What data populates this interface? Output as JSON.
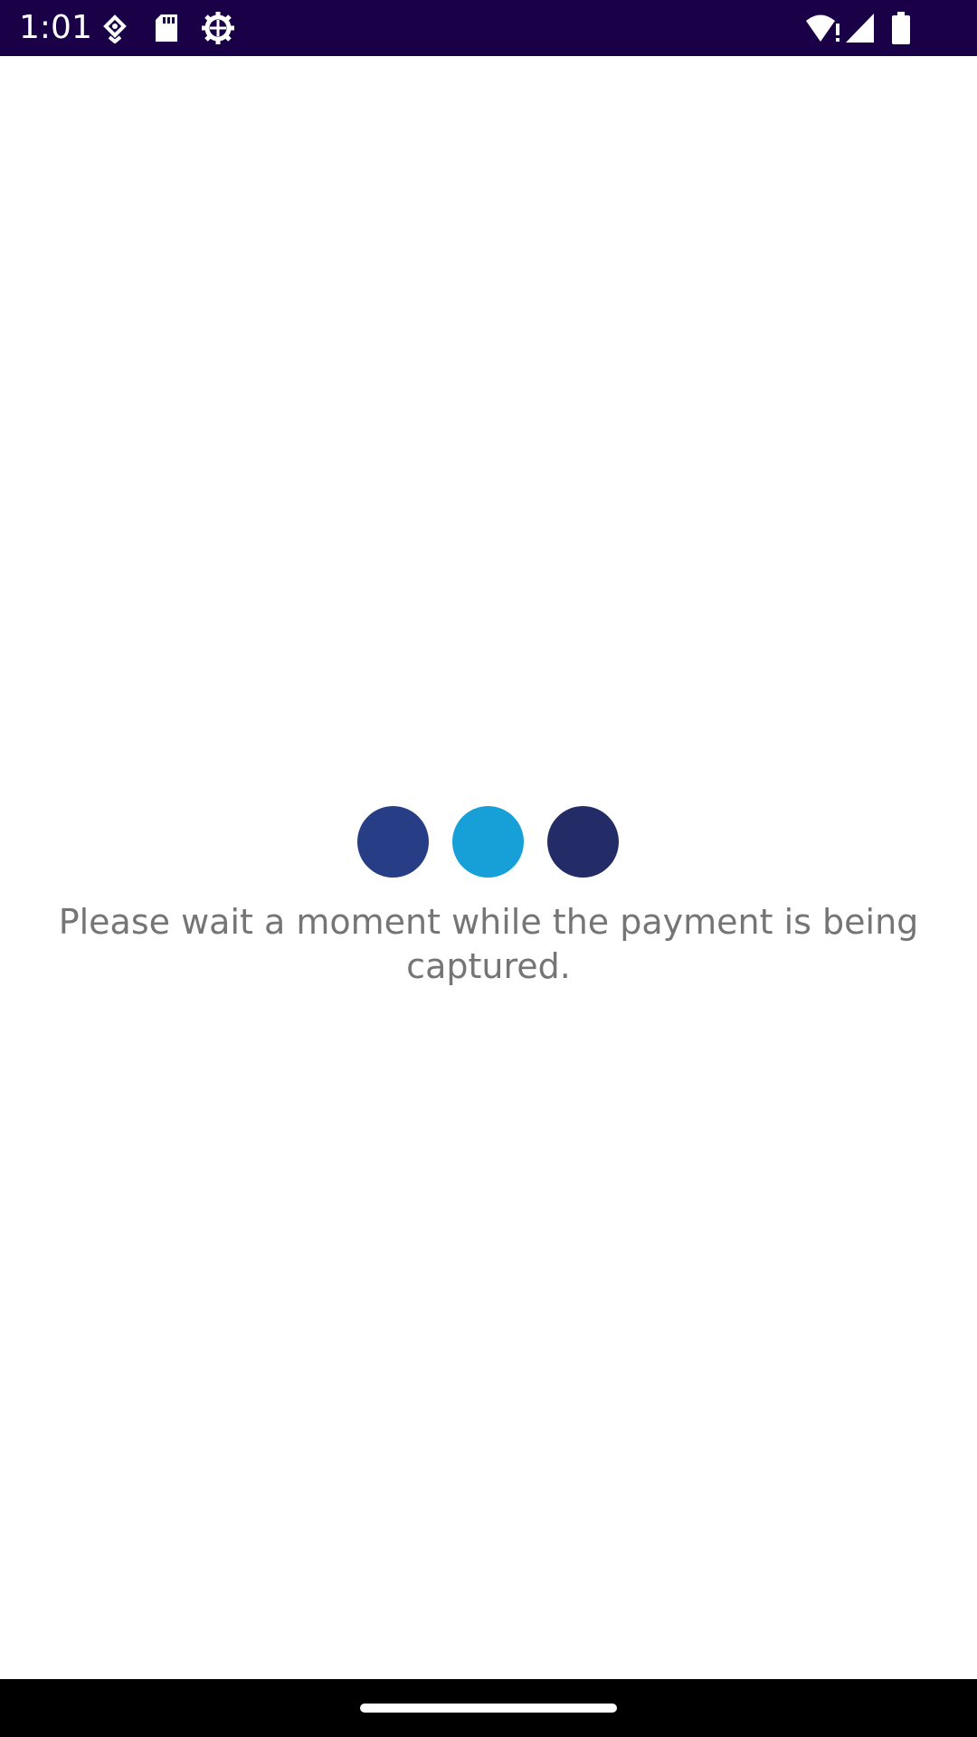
{
  "status_bar": {
    "time": "1:01",
    "background_color": "#1a0047",
    "left_icons": [
      "location-icon",
      "sd-card-icon",
      "settings-gear-icon"
    ],
    "right_icons": [
      "wifi-alert-icon",
      "cellular-signal-icon",
      "battery-icon"
    ]
  },
  "loading": {
    "dot_colors": [
      "#273d85",
      "#179fd7",
      "#232c66"
    ],
    "message": "Please wait a moment while the payment is being captured."
  },
  "nav_bar": {
    "background_color": "#000000"
  }
}
